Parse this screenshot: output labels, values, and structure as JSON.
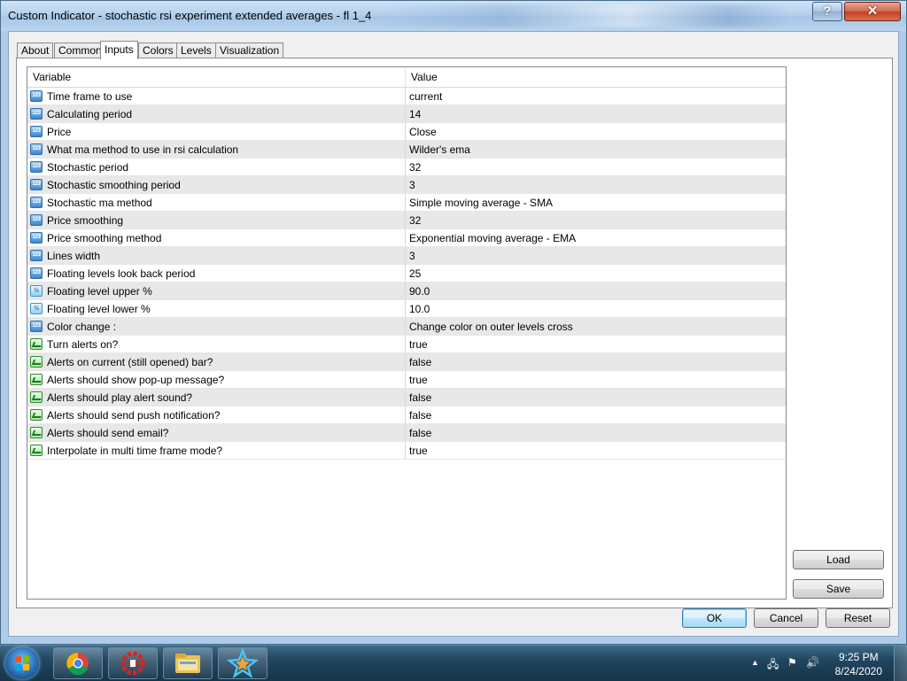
{
  "window": {
    "title": "Custom Indicator - stochastic rsi experiment extended averages - fl 1_4",
    "help_label": "?",
    "close_label": "✕"
  },
  "tabs": [
    {
      "label": "About"
    },
    {
      "label": "Common"
    },
    {
      "label": "Inputs",
      "active": true
    },
    {
      "label": "Colors"
    },
    {
      "label": "Levels"
    },
    {
      "label": "Visualization"
    }
  ],
  "grid": {
    "headers": {
      "variable": "Variable",
      "value": "Value"
    },
    "rows": [
      {
        "type": "int",
        "icon": "123",
        "variable": "Time frame to use",
        "value": "current"
      },
      {
        "type": "int",
        "icon": "123",
        "variable": "Calculating period",
        "value": "14"
      },
      {
        "type": "int",
        "icon": "123",
        "variable": "Price",
        "value": "Close"
      },
      {
        "type": "int",
        "icon": "123",
        "variable": "What ma method to use in rsi calculation",
        "value": "Wilder's ema"
      },
      {
        "type": "int",
        "icon": "123",
        "variable": "Stochastic period",
        "value": "32"
      },
      {
        "type": "int",
        "icon": "123",
        "variable": "Stochastic smoothing period",
        "value": "3"
      },
      {
        "type": "int",
        "icon": "123",
        "variable": "Stochastic ma method",
        "value": "Simple moving average - SMA"
      },
      {
        "type": "int",
        "icon": "123",
        "variable": "Price smoothing",
        "value": "32"
      },
      {
        "type": "int",
        "icon": "123",
        "variable": "Price smoothing method",
        "value": "Exponential moving average - EMA"
      },
      {
        "type": "int",
        "icon": "123",
        "variable": "Lines width",
        "value": "3"
      },
      {
        "type": "int",
        "icon": "123",
        "variable": "Floating levels look back period",
        "value": "25"
      },
      {
        "type": "dbl",
        "icon": "½",
        "variable": "Floating level upper %",
        "value": "90.0"
      },
      {
        "type": "dbl",
        "icon": "½",
        "variable": "Floating level lower %",
        "value": "10.0"
      },
      {
        "type": "int",
        "icon": "123",
        "variable": "Color change :",
        "value": "Change color on outer levels cross"
      },
      {
        "type": "bool",
        "icon": "",
        "variable": "Turn alerts on?",
        "value": "true"
      },
      {
        "type": "bool",
        "icon": "",
        "variable": "Alerts on current (still opened) bar?",
        "value": "false"
      },
      {
        "type": "bool",
        "icon": "",
        "variable": "Alerts should show pop-up message?",
        "value": "true"
      },
      {
        "type": "bool",
        "icon": "",
        "variable": "Alerts should play alert sound?",
        "value": "false"
      },
      {
        "type": "bool",
        "icon": "",
        "variable": "Alerts should send push notification?",
        "value": "false"
      },
      {
        "type": "bool",
        "icon": "",
        "variable": "Alerts should send email?",
        "value": "false"
      },
      {
        "type": "bool",
        "icon": "",
        "variable": "Interpolate in multi time frame mode?",
        "value": "true"
      }
    ]
  },
  "buttons": {
    "load": "Load",
    "save": "Save",
    "ok": "OK",
    "cancel": "Cancel",
    "reset": "Reset"
  },
  "taskbar": {
    "apps": [
      {
        "name": "chrome-icon"
      },
      {
        "name": "metatrader-icon"
      },
      {
        "name": "file-explorer-icon"
      },
      {
        "name": "star-app-icon"
      }
    ],
    "clock_time": "9:25 PM",
    "clock_date": "8/24/2020"
  },
  "colors": {
    "accent": "#3c7fb1",
    "grid_alt_row": "#e8e8e8",
    "close_button": "#c2401f"
  }
}
